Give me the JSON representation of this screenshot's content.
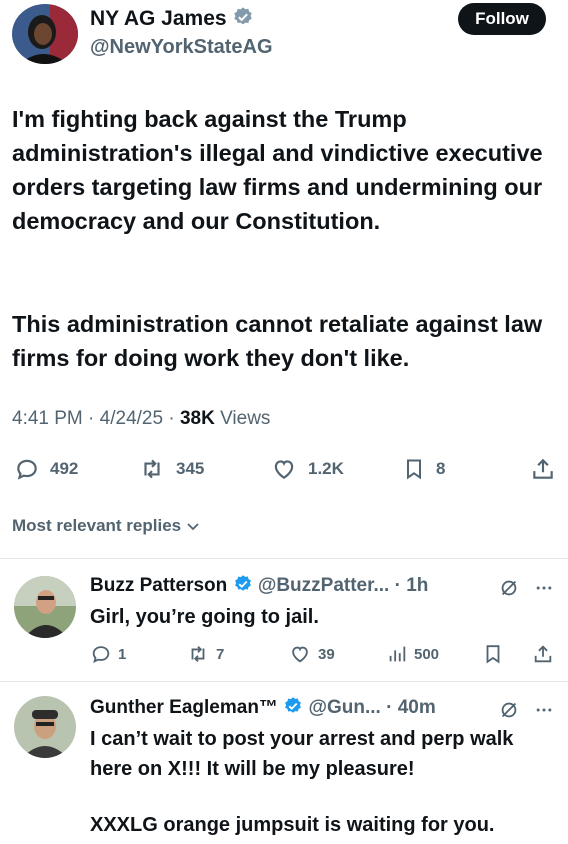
{
  "tweet": {
    "author_name": "NY AG James",
    "author_handle": "@NewYorkStateAG",
    "follow_label": "Follow",
    "text_p1": "I'm fighting back against the Trump administration's illegal and vindictive executive orders targeting law firms and undermining our democracy and our Constitution.",
    "text_p2": "This administration cannot retaliate against law firms for doing work they don't like.",
    "time": "4:41 PM",
    "date": "4/24/25",
    "views_count": "38K",
    "views_label": "Views",
    "replies": "492",
    "reposts": "345",
    "likes": "1.2K",
    "bookmarks": "8"
  },
  "replies_filter": {
    "label": "Most relevant replies"
  },
  "replies": [
    {
      "name": "Buzz Patterson",
      "handle": "@BuzzPatter...",
      "time": "1h",
      "text": "Girl, you’re going to jail.",
      "replies": "1",
      "reposts": "7",
      "likes": "39",
      "views": "500"
    },
    {
      "name": "Gunther Eagleman™",
      "handle": "@Gun...",
      "time": "40m",
      "text_p1": "I can’t wait to post your arrest and perp walk here on X!!!  It will be my pleasure!",
      "text_p2": "XXXLG orange jumpsuit is waiting for you."
    }
  ],
  "colors": {
    "verified": "#1d9bf0",
    "muted": "#536471",
    "text": "#0f1419"
  },
  "icons": [
    "reply-icon",
    "repost-icon",
    "like-icon",
    "bookmark-icon",
    "share-icon",
    "grok-icon",
    "more-icon",
    "views-icon",
    "verified-badge-icon",
    "chevron-down-icon"
  ]
}
